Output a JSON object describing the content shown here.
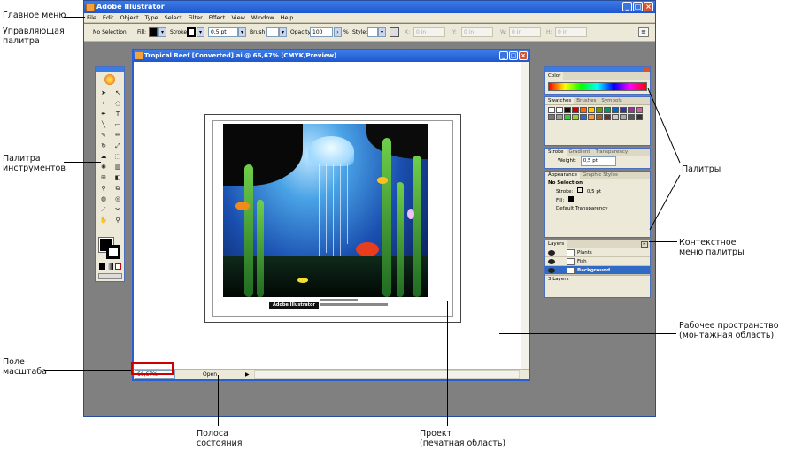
{
  "annotations": {
    "main_menu": "Главное меню",
    "control_palette": [
      "Управляющая",
      "палитра"
    ],
    "tools_palette": [
      "Палитра",
      "инструментов"
    ],
    "zoom_field": [
      "Поле",
      "масштаба"
    ],
    "status_bar": [
      "Полоса",
      "состояния"
    ],
    "project": [
      "Проект",
      "(печатная область)"
    ],
    "workspace": [
      "Рабочее пространство",
      "(монтажная область)"
    ],
    "palettes": "Палитры",
    "context_menu": [
      "Контекстное",
      "меню палитры"
    ]
  },
  "app": {
    "title": "Adobe Illustrator",
    "menu": [
      "File",
      "Edit",
      "Object",
      "Type",
      "Select",
      "Filter",
      "Effect",
      "View",
      "Window",
      "Help"
    ]
  },
  "control": {
    "selection": "No Selection",
    "fill_label": "Fill:",
    "stroke_label": "Stroke:",
    "stroke_weight": "0,5 pt",
    "brush_label": "Brush:",
    "opacity_label": "Opacity:",
    "opacity_value": "100",
    "percent": "%",
    "style_label": "Style:",
    "x_label": "X:",
    "y_label": "Y:",
    "w_label": "W:",
    "h_label": "H:",
    "coord_value": "0 in"
  },
  "document": {
    "title": "Tropical Reef [Converted].ai @ 66,67% (CMYK/Preview)",
    "zoom": "66,67%",
    "status": "Open",
    "logo_text": "Adobe Illustrator"
  },
  "panels": {
    "color_tab": "Color",
    "swatches_tabs": [
      "Swatches",
      "Brushes",
      "Symbols"
    ],
    "stroke_tabs": [
      "Stroke",
      "Gradient",
      "Transparency"
    ],
    "weight_label": "Weight:",
    "weight_value": "0,5 pt",
    "appearance_tabs": [
      "Appearance",
      "Graphic Styles"
    ],
    "appearance_header": "No Selection",
    "appearance_stroke": "Stroke:",
    "appearance_stroke_value": "0,5 pt",
    "appearance_fill": "Fill:",
    "appearance_transparency": "Default Transparency",
    "layers_tab": "Layers",
    "layers": [
      "Plants",
      "Fish",
      "Background"
    ],
    "layers_count": "3 Layers"
  },
  "colors": {
    "titlebar": "#1f56cf",
    "workspace": "#808080",
    "selected_layer": "#316ac5"
  }
}
